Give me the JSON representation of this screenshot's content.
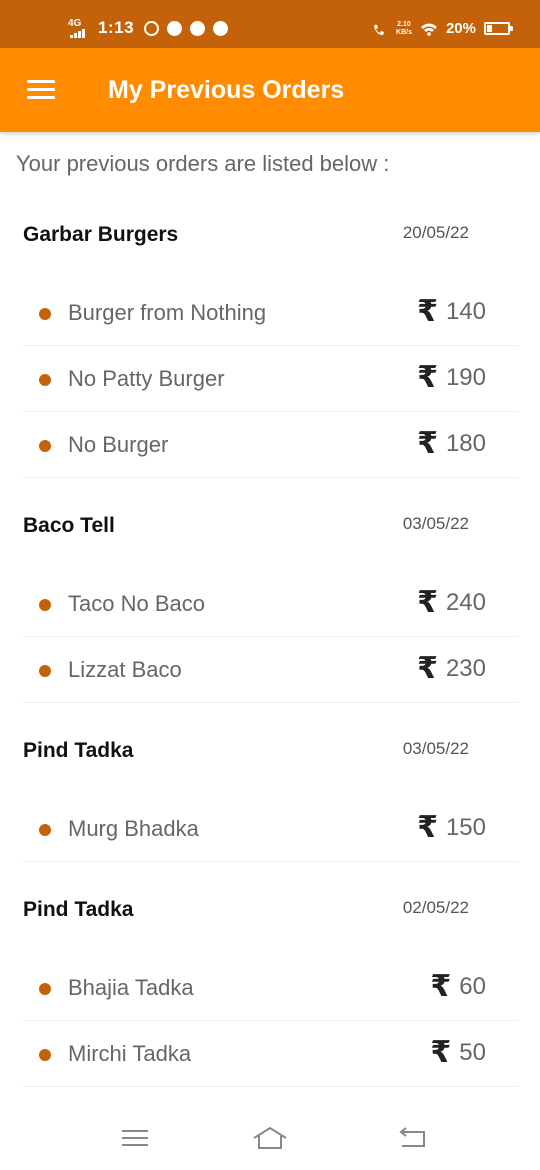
{
  "status_bar": {
    "network": "4G",
    "time": "1:13",
    "speed_value": "2.10",
    "speed_unit": "KB/s",
    "battery": "20%"
  },
  "app_bar": {
    "title": "My Previous Orders",
    "menu_icon": "hamburger-icon"
  },
  "subtitle": "Your previous orders are listed below :",
  "currency_symbol": "₹",
  "orders": [
    {
      "restaurant": "Garbar Burgers",
      "date": "20/05/22",
      "items": [
        {
          "name": "Burger from Nothing",
          "price": "140"
        },
        {
          "name": "No Patty Burger",
          "price": "190"
        },
        {
          "name": "No Burger",
          "price": "180"
        }
      ]
    },
    {
      "restaurant": "Baco Tell",
      "date": "03/05/22",
      "items": [
        {
          "name": "Taco No Baco",
          "price": "240"
        },
        {
          "name": "Lizzat Baco",
          "price": "230"
        }
      ]
    },
    {
      "restaurant": "Pind Tadka",
      "date": "03/05/22",
      "items": [
        {
          "name": "Murg Bhadka",
          "price": "150"
        }
      ]
    },
    {
      "restaurant": "Pind Tadka",
      "date": "02/05/22",
      "items": [
        {
          "name": "Bhajia Tadka",
          "price": "60"
        },
        {
          "name": "Mirchi Tadka",
          "price": "50"
        }
      ]
    }
  ],
  "colors": {
    "status_bar": "#c4620a",
    "app_bar": "#ff8c00",
    "bullet": "#c4620a"
  },
  "nav_bar": {
    "icons": [
      "menu-icon",
      "home-icon",
      "back-icon"
    ]
  }
}
